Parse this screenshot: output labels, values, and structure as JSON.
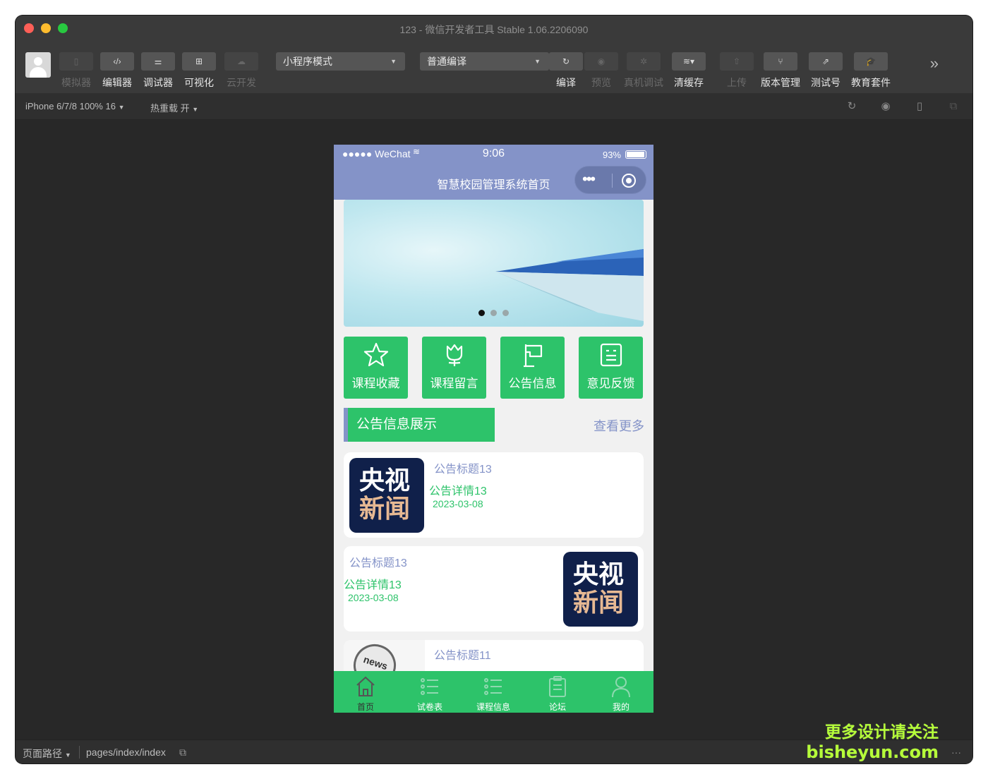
{
  "window": {
    "title": "123 - 微信开发者工具 Stable 1.06.2206090"
  },
  "toolbar": {
    "left_buttons": [
      {
        "label": "模拟器",
        "icon": "phone-icon",
        "state": "disabled"
      },
      {
        "label": "编辑器",
        "icon": "code-icon"
      },
      {
        "label": "调试器",
        "icon": "debug-icon"
      },
      {
        "label": "可视化",
        "icon": "layout-icon"
      },
      {
        "label": "云开发",
        "icon": "cloud-icon",
        "state": "disabled"
      }
    ],
    "mode_select": "小程序模式",
    "compile_select": "普通编译",
    "right_buttons": [
      {
        "label": "编译",
        "icon": "refresh-icon"
      },
      {
        "label": "预览",
        "icon": "eye-icon",
        "state": "disabled"
      },
      {
        "label": "真机调试",
        "icon": "bug-icon",
        "state": "disabled"
      },
      {
        "label": "清缓存",
        "icon": "layers-icon"
      },
      {
        "label": "上传",
        "icon": "upload-icon",
        "state": "disabled"
      },
      {
        "label": "版本管理",
        "icon": "branch-icon"
      },
      {
        "label": "测试号",
        "icon": "external-link-icon"
      },
      {
        "label": "教育套件",
        "icon": "graduation-cap-icon"
      }
    ],
    "more_glyph": "»"
  },
  "subbar": {
    "device": "iPhone 6/7/8 100% 16",
    "hot_reload": "热重载 开"
  },
  "footer": {
    "path_label": "页面路径",
    "path": "pages/index/index"
  },
  "phone": {
    "status": {
      "carrier": "●●●●● WeChat",
      "time": "9:06",
      "battery": "93%"
    },
    "nav_title": "智慧校园管理系统首页",
    "capsule_dots": "•••",
    "banner": {
      "slide_count": 3,
      "active_index": 0
    },
    "menu": [
      {
        "label": "课程收藏",
        "icon": "star-icon"
      },
      {
        "label": "课程留言",
        "icon": "tulip-icon"
      },
      {
        "label": "公告信息",
        "icon": "flag-icon"
      },
      {
        "label": "意见反馈",
        "icon": "feedback-icon"
      }
    ],
    "section": {
      "title": "公告信息展示",
      "more": "查看更多"
    },
    "notices": [
      {
        "title": "公告标题13",
        "detail": "公告详情13",
        "date": "2023-03-08",
        "logo_line1": "央视",
        "logo_line2": "新闻"
      },
      {
        "title": "公告标题13",
        "detail": "公告详情13",
        "date": "2023-03-08",
        "logo_line1": "央视",
        "logo_line2": "新闻"
      },
      {
        "title": "公告标题11",
        "news_badge": "news"
      }
    ],
    "tabbar": [
      {
        "label": "首页",
        "icon": "home-icon"
      },
      {
        "label": "试卷表",
        "icon": "list-icon"
      },
      {
        "label": "课程信息",
        "icon": "list-icon"
      },
      {
        "label": "论坛",
        "icon": "clipboard-icon"
      },
      {
        "label": "我的",
        "icon": "user-icon"
      }
    ]
  },
  "watermark": {
    "line1": "更多设计请关注",
    "line2": "bisheyun.com"
  }
}
